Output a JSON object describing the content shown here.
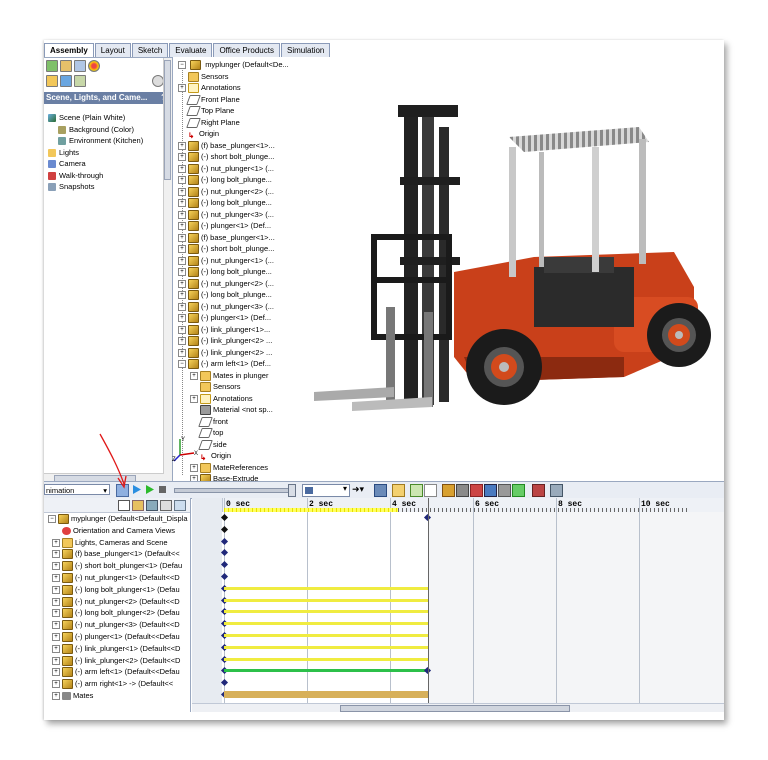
{
  "tabs": [
    "Assembly",
    "Layout",
    "Sketch",
    "Evaluate",
    "Office Products",
    "Simulation"
  ],
  "property_manager": {
    "title": "Scene, Lights, and Came...",
    "help": "?",
    "items": [
      {
        "label": "Scene (Plain White)",
        "indent": 0,
        "icon": "scene-icon"
      },
      {
        "label": "Background (Color)",
        "indent": 1,
        "icon": "background-icon"
      },
      {
        "label": "Environment (Kitchen)",
        "indent": 1,
        "icon": "environment-icon"
      },
      {
        "label": "Lights",
        "indent": 0,
        "icon": "lights-folder-icon"
      },
      {
        "label": "Camera",
        "indent": 0,
        "icon": "camera-icon"
      },
      {
        "label": "Walk-through",
        "indent": 0,
        "icon": "walkthrough-icon"
      },
      {
        "label": "Snapshots",
        "indent": 0,
        "icon": "snapshots-icon"
      }
    ]
  },
  "feature_tree": {
    "root": "myplunger  (Default<De...",
    "items": [
      {
        "label": "Sensors",
        "icon": "folder",
        "exp": ""
      },
      {
        "label": "Annotations",
        "icon": "annot",
        "exp": "+"
      },
      {
        "label": "Front Plane",
        "icon": "plane",
        "exp": ""
      },
      {
        "label": "Top Plane",
        "icon": "plane",
        "exp": ""
      },
      {
        "label": "Right Plane",
        "icon": "plane",
        "exp": ""
      },
      {
        "label": "Origin",
        "icon": "orig",
        "exp": ""
      },
      {
        "label": "(f) base_plunger<1>...",
        "icon": "gold",
        "exp": "+"
      },
      {
        "label": "(-) short bolt_plunge...",
        "icon": "gold",
        "exp": "+"
      },
      {
        "label": "(-) nut_plunger<1> (...",
        "icon": "gold",
        "exp": "+"
      },
      {
        "label": "(-) long bolt_plunge...",
        "icon": "gold",
        "exp": "+"
      },
      {
        "label": "(-) nut_plunger<2> (...",
        "icon": "gold",
        "exp": "+"
      },
      {
        "label": "(-) long bolt_plunge...",
        "icon": "gold",
        "exp": "+"
      },
      {
        "label": "(-) nut_plunger<3> (...",
        "icon": "gold",
        "exp": "+"
      },
      {
        "label": "(-) plunger<1> (Def...",
        "icon": "gold",
        "exp": "+"
      },
      {
        "label": "(f) base_plunger<1>...",
        "icon": "gold",
        "exp": "+"
      },
      {
        "label": "(-) short bolt_plunge...",
        "icon": "gold",
        "exp": "+"
      },
      {
        "label": "(-) nut_plunger<1> (...",
        "icon": "gold",
        "exp": "+"
      },
      {
        "label": "(-) long bolt_plunge...",
        "icon": "gold",
        "exp": "+"
      },
      {
        "label": "(-) nut_plunger<2> (...",
        "icon": "gold",
        "exp": "+"
      },
      {
        "label": "(-) long bolt_plunge...",
        "icon": "gold",
        "exp": "+"
      },
      {
        "label": "(-) nut_plunger<3> (...",
        "icon": "gold",
        "exp": "+"
      },
      {
        "label": "(-) plunger<1> (Def...",
        "icon": "gold",
        "exp": "+"
      },
      {
        "label": "(-) link_plunger<1>...",
        "icon": "gold",
        "exp": "+"
      },
      {
        "label": "(-) link_plunger<2> ...",
        "icon": "gold",
        "exp": "+"
      },
      {
        "label": "(-) link_plunger<2> ...",
        "icon": "gold",
        "exp": "+"
      },
      {
        "label": "(-) arm left<1> (Def...",
        "icon": "gold",
        "exp": "-"
      },
      {
        "label": "Mates in plunger",
        "icon": "folder",
        "exp": "+",
        "sub": true
      },
      {
        "label": "Sensors",
        "icon": "folder",
        "exp": "",
        "sub": true
      },
      {
        "label": "Annotations",
        "icon": "annot",
        "exp": "+",
        "sub": true
      },
      {
        "label": "Material <not sp...",
        "icon": "mat",
        "exp": "",
        "sub": true
      },
      {
        "label": "front",
        "icon": "plane",
        "exp": "",
        "sub": true
      },
      {
        "label": "top",
        "icon": "plane",
        "exp": "",
        "sub": true
      },
      {
        "label": "side",
        "icon": "plane",
        "exp": "",
        "sub": true
      },
      {
        "label": "Origin",
        "icon": "orig",
        "exp": "",
        "sub": true
      },
      {
        "label": "MateReferences",
        "icon": "folder",
        "exp": "+",
        "sub": true
      },
      {
        "label": "Base-Extrude",
        "icon": "gold",
        "exp": "+",
        "sub": true
      }
    ]
  },
  "animation": {
    "mode": "nimation",
    "ticks": [
      "0 sec",
      "2 sec",
      "4 sec",
      "6 sec",
      "8 sec",
      "10 sec"
    ]
  },
  "motion_tree": {
    "items": [
      {
        "label": "myplunger  (Default<Default_Displa",
        "icon": "gold",
        "exp": "-"
      },
      {
        "label": "Orientation and Camera Views",
        "icon": "orient",
        "exp": ""
      },
      {
        "label": "Lights, Cameras and Scene",
        "icon": "folder",
        "exp": "+"
      },
      {
        "label": "(f) base_plunger<1> (Default<<",
        "icon": "gold",
        "exp": "+"
      },
      {
        "label": "(-) short bolt_plunger<1> (Defau",
        "icon": "gold",
        "exp": "+"
      },
      {
        "label": "(-) nut_plunger<1> (Default<<D",
        "icon": "gold",
        "exp": "+"
      },
      {
        "label": "(-) long bolt_plunger<1> (Defau",
        "icon": "gold",
        "exp": "+"
      },
      {
        "label": "(-) nut_plunger<2> (Default<<D",
        "icon": "gold",
        "exp": "+"
      },
      {
        "label": "(-) long bolt_plunger<2> (Defau",
        "icon": "gold",
        "exp": "+"
      },
      {
        "label": "(-) nut_plunger<3> (Default<<D",
        "icon": "gold",
        "exp": "+"
      },
      {
        "label": "(-) plunger<1> (Default<<Defau",
        "icon": "gold",
        "exp": "+"
      },
      {
        "label": "(-) link_plunger<1> (Default<<D",
        "icon": "gold",
        "exp": "+"
      },
      {
        "label": "(-) link_plunger<2> (Default<<D",
        "icon": "gold",
        "exp": "+"
      },
      {
        "label": "(-) arm left<1> (Default<<Defau",
        "icon": "gold",
        "exp": "+"
      },
      {
        "label": "(-) arm right<1> -> (Default<<",
        "icon": "gold",
        "exp": "+"
      },
      {
        "label": "Mates",
        "icon": "mates",
        "exp": "+"
      }
    ]
  },
  "colors": {
    "forklift_body": "#c9401a",
    "timeline_yellow": "#f0ec40",
    "timeline_green": "#2cc04a",
    "keyframe": "#20287a"
  }
}
